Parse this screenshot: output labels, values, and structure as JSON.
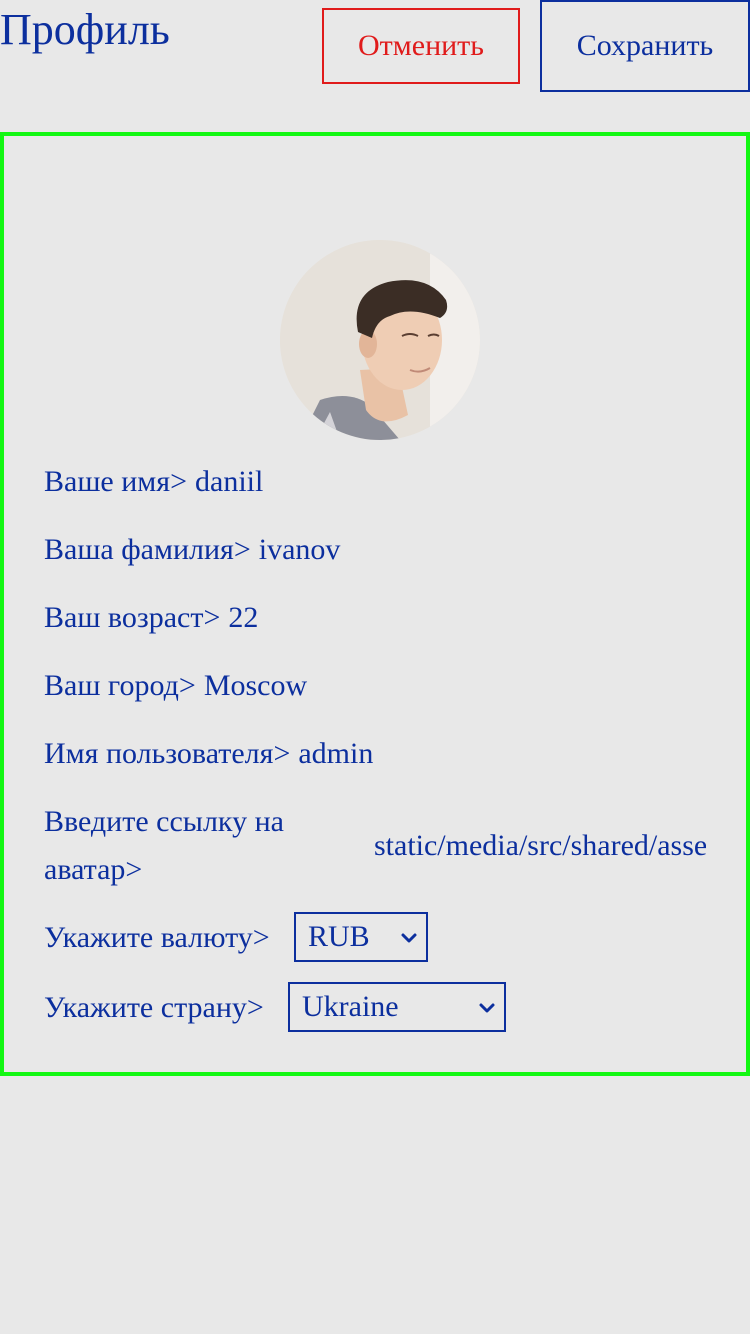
{
  "header": {
    "title": "Профиль",
    "cancel_label": "Отменить",
    "save_label": "Сохранить"
  },
  "profile": {
    "fields": [
      {
        "label": "Ваше имя>",
        "value": "daniil"
      },
      {
        "label": "Ваша фамилия>",
        "value": "ivanov"
      },
      {
        "label": "Ваш возраст>",
        "value": "22"
      },
      {
        "label": "Ваш город>",
        "value": "Moscow"
      },
      {
        "label": "Имя пользователя>",
        "value": "admin"
      }
    ],
    "avatar_link": {
      "label": "Введите ссылку на аватар>",
      "value": "static/media/src/shared/assets"
    },
    "currency": {
      "label": "Укажите валюту>",
      "selected": "RUB"
    },
    "country": {
      "label": "Укажите страну>",
      "selected": "Ukraine"
    }
  },
  "colors": {
    "text": "#0c2f9e",
    "cancel": "#e01b1b",
    "panel_border": "#13f713",
    "background": "#e8e8e8"
  },
  "icons": {
    "select_arrow": "chevron-down-icon"
  }
}
